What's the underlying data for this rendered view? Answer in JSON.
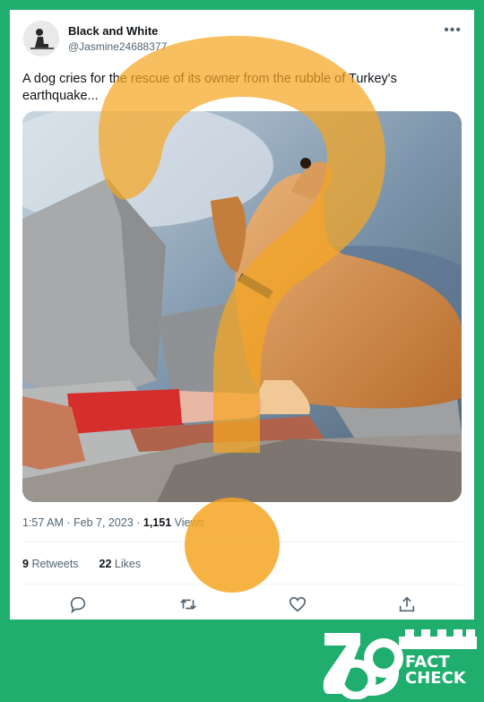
{
  "tweet": {
    "display_name": "Black and White",
    "handle": "@Jasmine24688377",
    "more_icon": "more-horizontal-icon",
    "text": "A dog cries for the rescue of its owner from the rubble of Turkey's earthquake...",
    "time": "1:57 AM",
    "date": "Feb 7, 2023",
    "separator": "·",
    "views_count": "1,151",
    "views_label": "Views",
    "retweets_count": "9",
    "retweets_label": "Retweets",
    "likes_count": "22",
    "likes_label": "Likes"
  },
  "actions": [
    "reply-icon",
    "retweet-icon",
    "like-icon",
    "share-icon"
  ],
  "overlay": {
    "symbol": "question-mark",
    "color": "#f5a623"
  },
  "brand": {
    "line1": "FACT",
    "line2": "CHECK",
    "background": "#1fae6e"
  }
}
